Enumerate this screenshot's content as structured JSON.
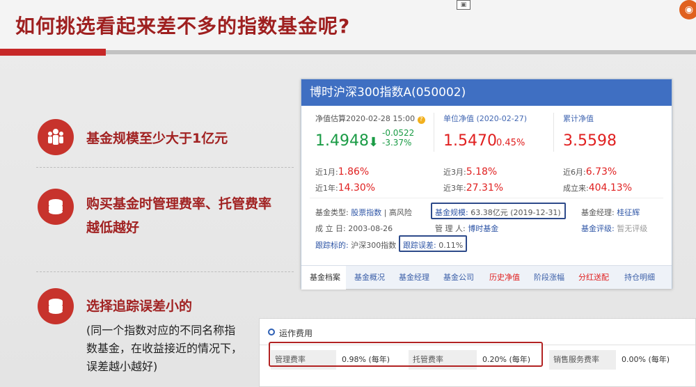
{
  "slide": {
    "title": "如何挑选看起来差不多的指数基金呢?",
    "features": [
      {
        "text": "基金规模至少大于1亿元",
        "icon": "people-icon"
      },
      {
        "text": "购买基金时管理费率、托管费率越低越好",
        "line1": "购买基金时管理费率、托管费率",
        "line2": "越低越好",
        "icon": "coins-icon"
      },
      {
        "text": "选择追踪误差小的",
        "icon": "coins-icon"
      }
    ],
    "sub_lines": [
      "(同一个指数对应的不同名称指",
      "数基金，在收益接近的情况下，",
      "误差越小越好)"
    ]
  },
  "fund": {
    "name": "博时沪深300指数A(050002)",
    "estimate_label": "净值估算2020-02-28 15:00",
    "estimate_value": "1.4948",
    "estimate_change": "-0.0522",
    "estimate_pct": "-3.37%",
    "nav_label": "单位净值 (2020-02-27)",
    "nav_value": "1.5470",
    "nav_pct": "0.45%",
    "acc_label": "累计净值",
    "acc_value": "3.5598",
    "returns": [
      {
        "label": "近1月:",
        "value": "1.86%"
      },
      {
        "label": "近3月:",
        "value": "5.18%"
      },
      {
        "label": "近6月:",
        "value": "6.73%"
      },
      {
        "label": "近1年:",
        "value": "14.30%"
      },
      {
        "label": "近3年:",
        "value": "27.31%"
      },
      {
        "label": "成立来:",
        "value": "404.13%"
      }
    ],
    "type_label": "基金类型:",
    "type_value": "股票指数",
    "risk": "高风险",
    "scale_label": "基金规模:",
    "scale_value": "63.38亿元 (2019-12-31)",
    "manager_label": "基金经理:",
    "manager_value": "桂征辉",
    "setup_label": "成 立 日:",
    "setup_value": "2003-08-26",
    "company_label": "管 理 人:",
    "company_value": "博时基金",
    "rating_label": "基金评级:",
    "rating_value": "暂无评级",
    "track_label": "跟踪标的:",
    "track_value": "沪深300指数",
    "error_label": "跟踪误差:",
    "error_value": "0.11%",
    "tabs": [
      "基金档案",
      "基金概况",
      "基金经理",
      "基金公司",
      "历史净值",
      "阶段涨幅",
      "分红送配",
      "持仓明细"
    ]
  },
  "cost": {
    "title": "运作费用",
    "items": [
      {
        "label": "管理费率",
        "value": "0.98% (每年)"
      },
      {
        "label": "托管费率",
        "value": "0.20% (每年)"
      },
      {
        "label": "销售服务费率",
        "value": "0.00% (每年)"
      }
    ]
  }
}
